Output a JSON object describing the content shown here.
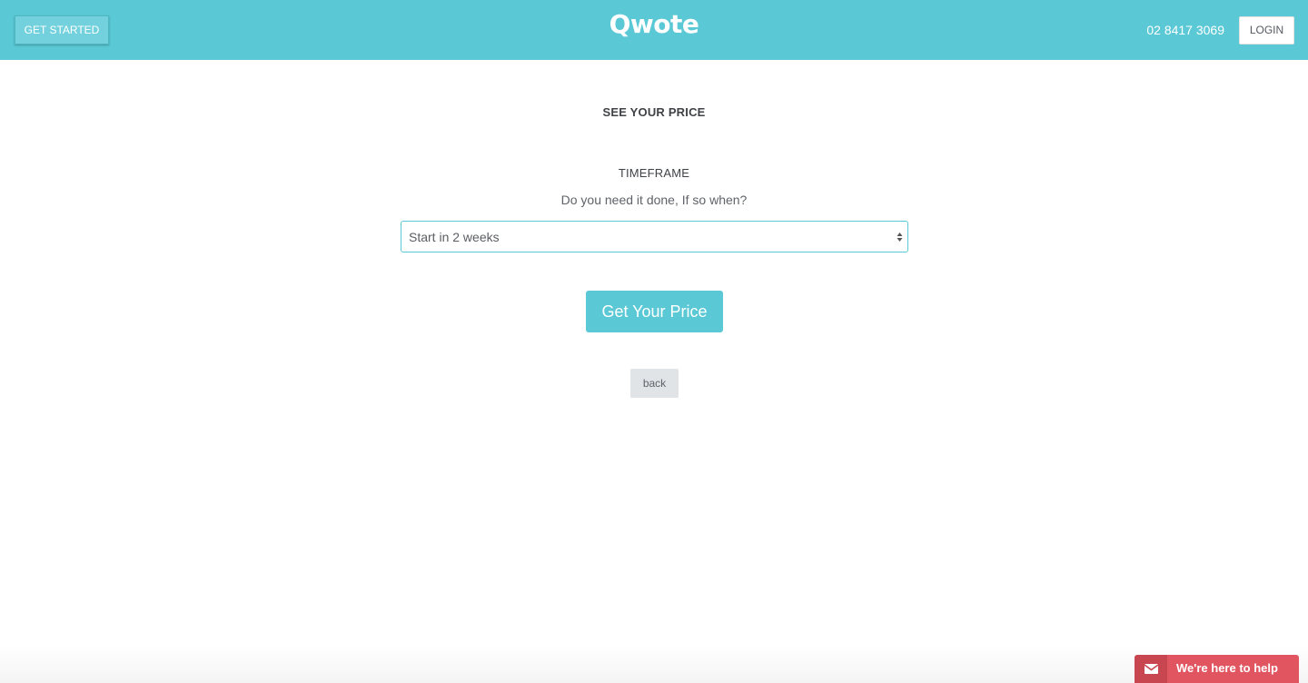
{
  "header": {
    "get_started_label": "GET STARTED",
    "logo_text": "Qwote",
    "phone": "02 8417 3069",
    "login_label": "LOGIN",
    "background_color": "#5ac8d5"
  },
  "main": {
    "heading": "SEE YOUR PRICE",
    "section_title": "TIMEFRAME",
    "question": "Do you need it done, If so when?",
    "timeframe_select": {
      "selected_value": "Start in 2 weeks"
    },
    "get_price_label": "Get Your Price",
    "back_label": "back"
  },
  "help_widget": {
    "label": "We're here to help",
    "icon": "mail-icon",
    "color": "#e15561"
  }
}
